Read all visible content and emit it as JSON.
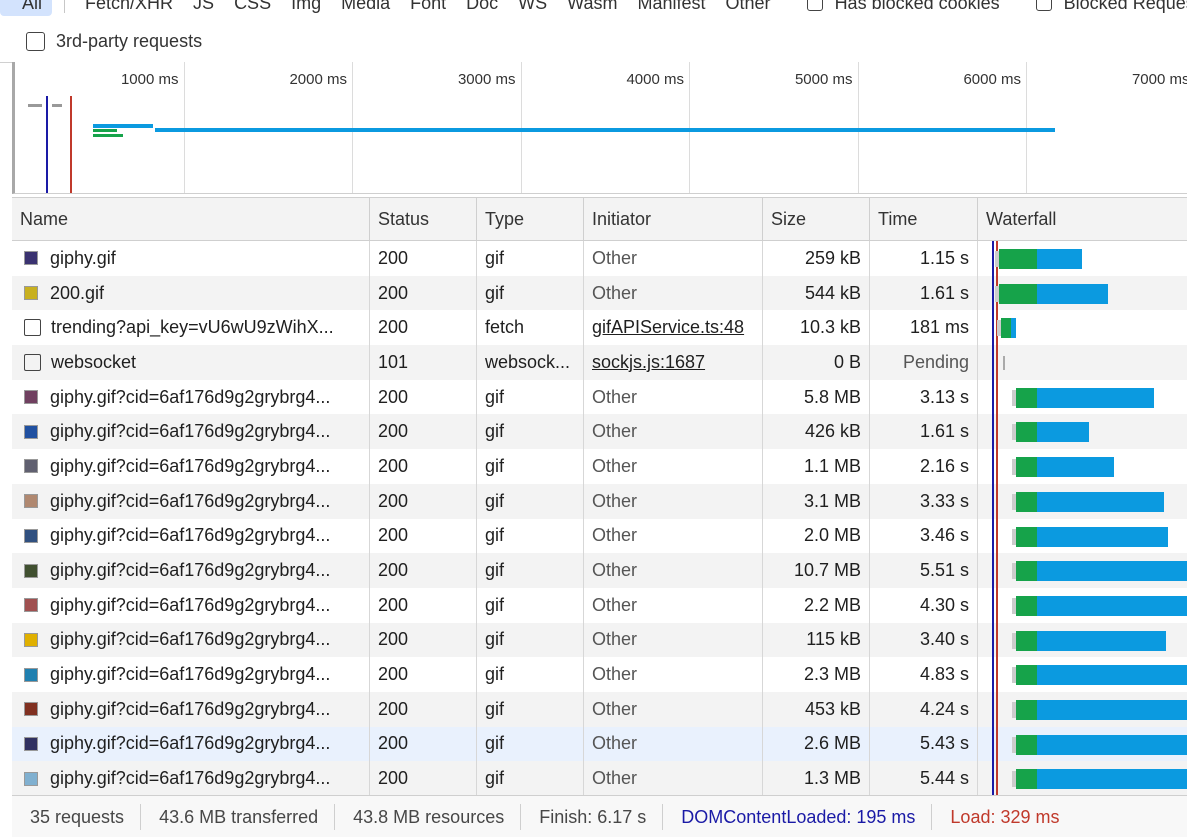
{
  "filters": {
    "types": [
      "All",
      "Fetch/XHR",
      "JS",
      "CSS",
      "Img",
      "Media",
      "Font",
      "Doc",
      "WS",
      "Wasm",
      "Manifest",
      "Other"
    ],
    "has_blocked_cookies": "Has blocked cookies",
    "blocked_requests": "Blocked Requests",
    "third_party": "3rd-party requests"
  },
  "overview": {
    "ticks": [
      "1000 ms",
      "2000 ms",
      "3000 ms",
      "4000 ms",
      "5000 ms",
      "6000 ms",
      "7000 ms"
    ],
    "colors": {
      "dcl": "#1a1aa6",
      "load": "#c0392b",
      "waiting": "#16a34a",
      "download": "#0b9ae0"
    }
  },
  "table": {
    "columns": [
      "Name",
      "Status",
      "Type",
      "Initiator",
      "Size",
      "Time",
      "Waterfall"
    ],
    "rows": [
      {
        "name": "giphy.gif",
        "status": "200",
        "type": "gif",
        "initiator": "Other",
        "size": "259 kB",
        "time": "1.15 s",
        "icon": "gif-thumbnail",
        "thumb": "#3a3270",
        "wf": [
          0.1,
          0.18,
          0.22
        ]
      },
      {
        "name": "200.gif",
        "status": "200",
        "type": "gif",
        "initiator": "Other",
        "size": "544 kB",
        "time": "1.61 s",
        "icon": "gif-thumbnail",
        "thumb": "#c8b020",
        "wf": [
          0.1,
          0.18,
          0.34
        ]
      },
      {
        "name": "trending?api_key=vU6wU9zWihX...",
        "status": "200",
        "type": "fetch",
        "initiator": "gifAPIService.ts:48",
        "size": "10.3 kB",
        "time": "181 ms",
        "icon": "document-icon",
        "link": true,
        "wf": [
          0.11,
          0.05,
          0.02
        ]
      },
      {
        "name": "websocket",
        "status": "101",
        "type": "websock...",
        "initiator": "sockjs.js:1687",
        "size": "0 B",
        "time": "Pending",
        "icon": "document-icon",
        "link": true,
        "pending": true,
        "wf": [
          0.12,
          0,
          0
        ]
      },
      {
        "name": "giphy.gif?cid=6af176d9g2grybrg4...",
        "status": "200",
        "type": "gif",
        "initiator": "Other",
        "size": "5.8 MB",
        "time": "3.13 s",
        "icon": "gif-thumbnail",
        "thumb": "#704060",
        "wf": [
          0.18,
          0.1,
          0.56
        ]
      },
      {
        "name": "giphy.gif?cid=6af176d9g2grybrg4...",
        "status": "200",
        "type": "gif",
        "initiator": "Other",
        "size": "426 kB",
        "time": "1.61 s",
        "icon": "gif-thumbnail",
        "thumb": "#2050a0",
        "wf": [
          0.18,
          0.1,
          0.25
        ]
      },
      {
        "name": "giphy.gif?cid=6af176d9g2grybrg4...",
        "status": "200",
        "type": "gif",
        "initiator": "Other",
        "size": "1.1 MB",
        "time": "2.16 s",
        "icon": "gif-thumbnail",
        "thumb": "#606070",
        "wf": [
          0.18,
          0.1,
          0.37
        ]
      },
      {
        "name": "giphy.gif?cid=6af176d9g2grybrg4...",
        "status": "200",
        "type": "gif",
        "initiator": "Other",
        "size": "3.1 MB",
        "time": "3.33 s",
        "icon": "gif-thumbnail",
        "thumb": "#b08870",
        "wf": [
          0.18,
          0.1,
          0.61
        ]
      },
      {
        "name": "giphy.gif?cid=6af176d9g2grybrg4...",
        "status": "200",
        "type": "gif",
        "initiator": "Other",
        "size": "2.0 MB",
        "time": "3.46 s",
        "icon": "gif-thumbnail",
        "thumb": "#305080",
        "wf": [
          0.18,
          0.1,
          0.63
        ]
      },
      {
        "name": "giphy.gif?cid=6af176d9g2grybrg4...",
        "status": "200",
        "type": "gif",
        "initiator": "Other",
        "size": "10.7 MB",
        "time": "5.51 s",
        "icon": "gif-thumbnail",
        "thumb": "#405030",
        "wf": [
          0.18,
          0.1,
          0.8
        ]
      },
      {
        "name": "giphy.gif?cid=6af176d9g2grybrg4...",
        "status": "200",
        "type": "gif",
        "initiator": "Other",
        "size": "2.2 MB",
        "time": "4.30 s",
        "icon": "gif-thumbnail",
        "thumb": "#a05050",
        "wf": [
          0.18,
          0.1,
          0.8
        ]
      },
      {
        "name": "giphy.gif?cid=6af176d9g2grybrg4...",
        "status": "200",
        "type": "gif",
        "initiator": "Other",
        "size": "115 kB",
        "time": "3.40 s",
        "icon": "gif-thumbnail",
        "thumb": "#e0b000",
        "wf": [
          0.18,
          0.1,
          0.62
        ]
      },
      {
        "name": "giphy.gif?cid=6af176d9g2grybrg4...",
        "status": "200",
        "type": "gif",
        "initiator": "Other",
        "size": "2.3 MB",
        "time": "4.83 s",
        "icon": "gif-thumbnail",
        "thumb": "#2080b0",
        "wf": [
          0.18,
          0.1,
          0.8
        ]
      },
      {
        "name": "giphy.gif?cid=6af176d9g2grybrg4...",
        "status": "200",
        "type": "gif",
        "initiator": "Other",
        "size": "453 kB",
        "time": "4.24 s",
        "icon": "gif-thumbnail",
        "thumb": "#803020",
        "wf": [
          0.18,
          0.1,
          0.8
        ]
      },
      {
        "name": "giphy.gif?cid=6af176d9g2grybrg4...",
        "status": "200",
        "type": "gif",
        "initiator": "Other",
        "size": "2.6 MB",
        "time": "5.43 s",
        "icon": "gif-thumbnail",
        "thumb": "#303060",
        "wf": [
          0.18,
          0.1,
          0.8
        ]
      },
      {
        "name": "giphy.gif?cid=6af176d9g2grybrg4...",
        "status": "200",
        "type": "gif",
        "initiator": "Other",
        "size": "1.3 MB",
        "time": "5.44 s",
        "icon": "gif-thumbnail",
        "thumb": "#80b0d0",
        "wf": [
          0.18,
          0.1,
          0.8
        ]
      }
    ]
  },
  "status_bar": {
    "requests": "35 requests",
    "transferred": "43.6 MB transferred",
    "resources": "43.8 MB resources",
    "finish": "Finish: 6.17 s",
    "dcl": "DOMContentLoaded: 195 ms",
    "load": "Load: 329 ms"
  }
}
